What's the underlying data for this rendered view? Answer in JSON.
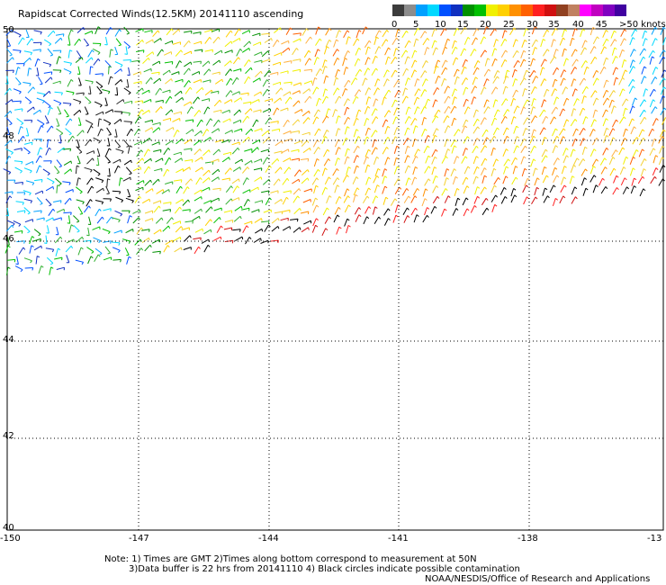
{
  "title": "Rapidscat Corrected Winds(12.5KM) 20141110 ascending",
  "colorbar": {
    "colors": [
      "#3c3c3c",
      "#8c8c8c",
      "#00a0ff",
      "#00d8ff",
      "#0050ff",
      "#1030c0",
      "#009000",
      "#00c000",
      "#f0f000",
      "#ffd000",
      "#ff9000",
      "#ff6000",
      "#ff2020",
      "#d01010",
      "#904020",
      "#c08060",
      "#ff00ff",
      "#c000c0",
      "#8000c0",
      "#4000a0"
    ],
    "labels": [
      "0",
      "5",
      "10",
      "15",
      "20",
      "25",
      "30",
      "35",
      "40",
      "45",
      ">50 knots"
    ]
  },
  "axes": {
    "x_ticks": [
      "-150",
      "-147",
      "-144",
      "-141",
      "-138",
      "-13"
    ],
    "y_ticks": [
      "50",
      "48",
      "46",
      "44",
      "42",
      "40"
    ]
  },
  "notes": {
    "line1": "Note: 1) Times are GMT 2)Times along bottom correspond to measurement at 50N",
    "line2": "3)Data buffer is 22 hrs from 20141110 4) Black circles indicate possible contamination",
    "credit": "NOAA/NESDIS/Office of Research and Applications"
  }
}
